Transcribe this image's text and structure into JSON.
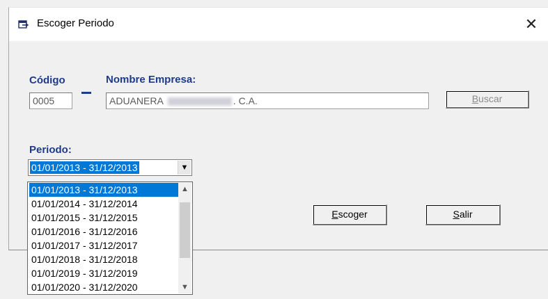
{
  "window": {
    "title": "Escoger Periodo",
    "close_glyph": "✕"
  },
  "fields": {
    "codigo_label": "Código",
    "codigo_value": "0005",
    "nombre_label": "Nombre Empresa:",
    "nombre_prefix": "ADUANERA",
    "nombre_suffix": ". C.A.",
    "periodo_label": "Periodo:"
  },
  "buttons": {
    "buscar": {
      "mnemonic": "B",
      "rest": "uscar"
    },
    "escoger": {
      "mnemonic": "E",
      "rest": "scoger"
    },
    "salir": {
      "mnemonic": "S",
      "rest": "alir"
    }
  },
  "periodo": {
    "selected": "01/01/2013 - 31/12/2013",
    "options": [
      "01/01/2013 - 31/12/2013",
      "01/01/2014 - 31/12/2014",
      "01/01/2015 - 31/12/2015",
      "01/01/2016 - 31/12/2016",
      "01/01/2017 - 31/12/2017",
      "01/01/2018 - 31/12/2018",
      "01/01/2019 - 31/12/2019",
      "01/01/2020 - 31/12/2020"
    ]
  },
  "colors": {
    "label_blue": "#1e3a8a",
    "selection": "#0078d7"
  },
  "icons": {
    "title": "window-app-icon",
    "close": "close-icon"
  }
}
